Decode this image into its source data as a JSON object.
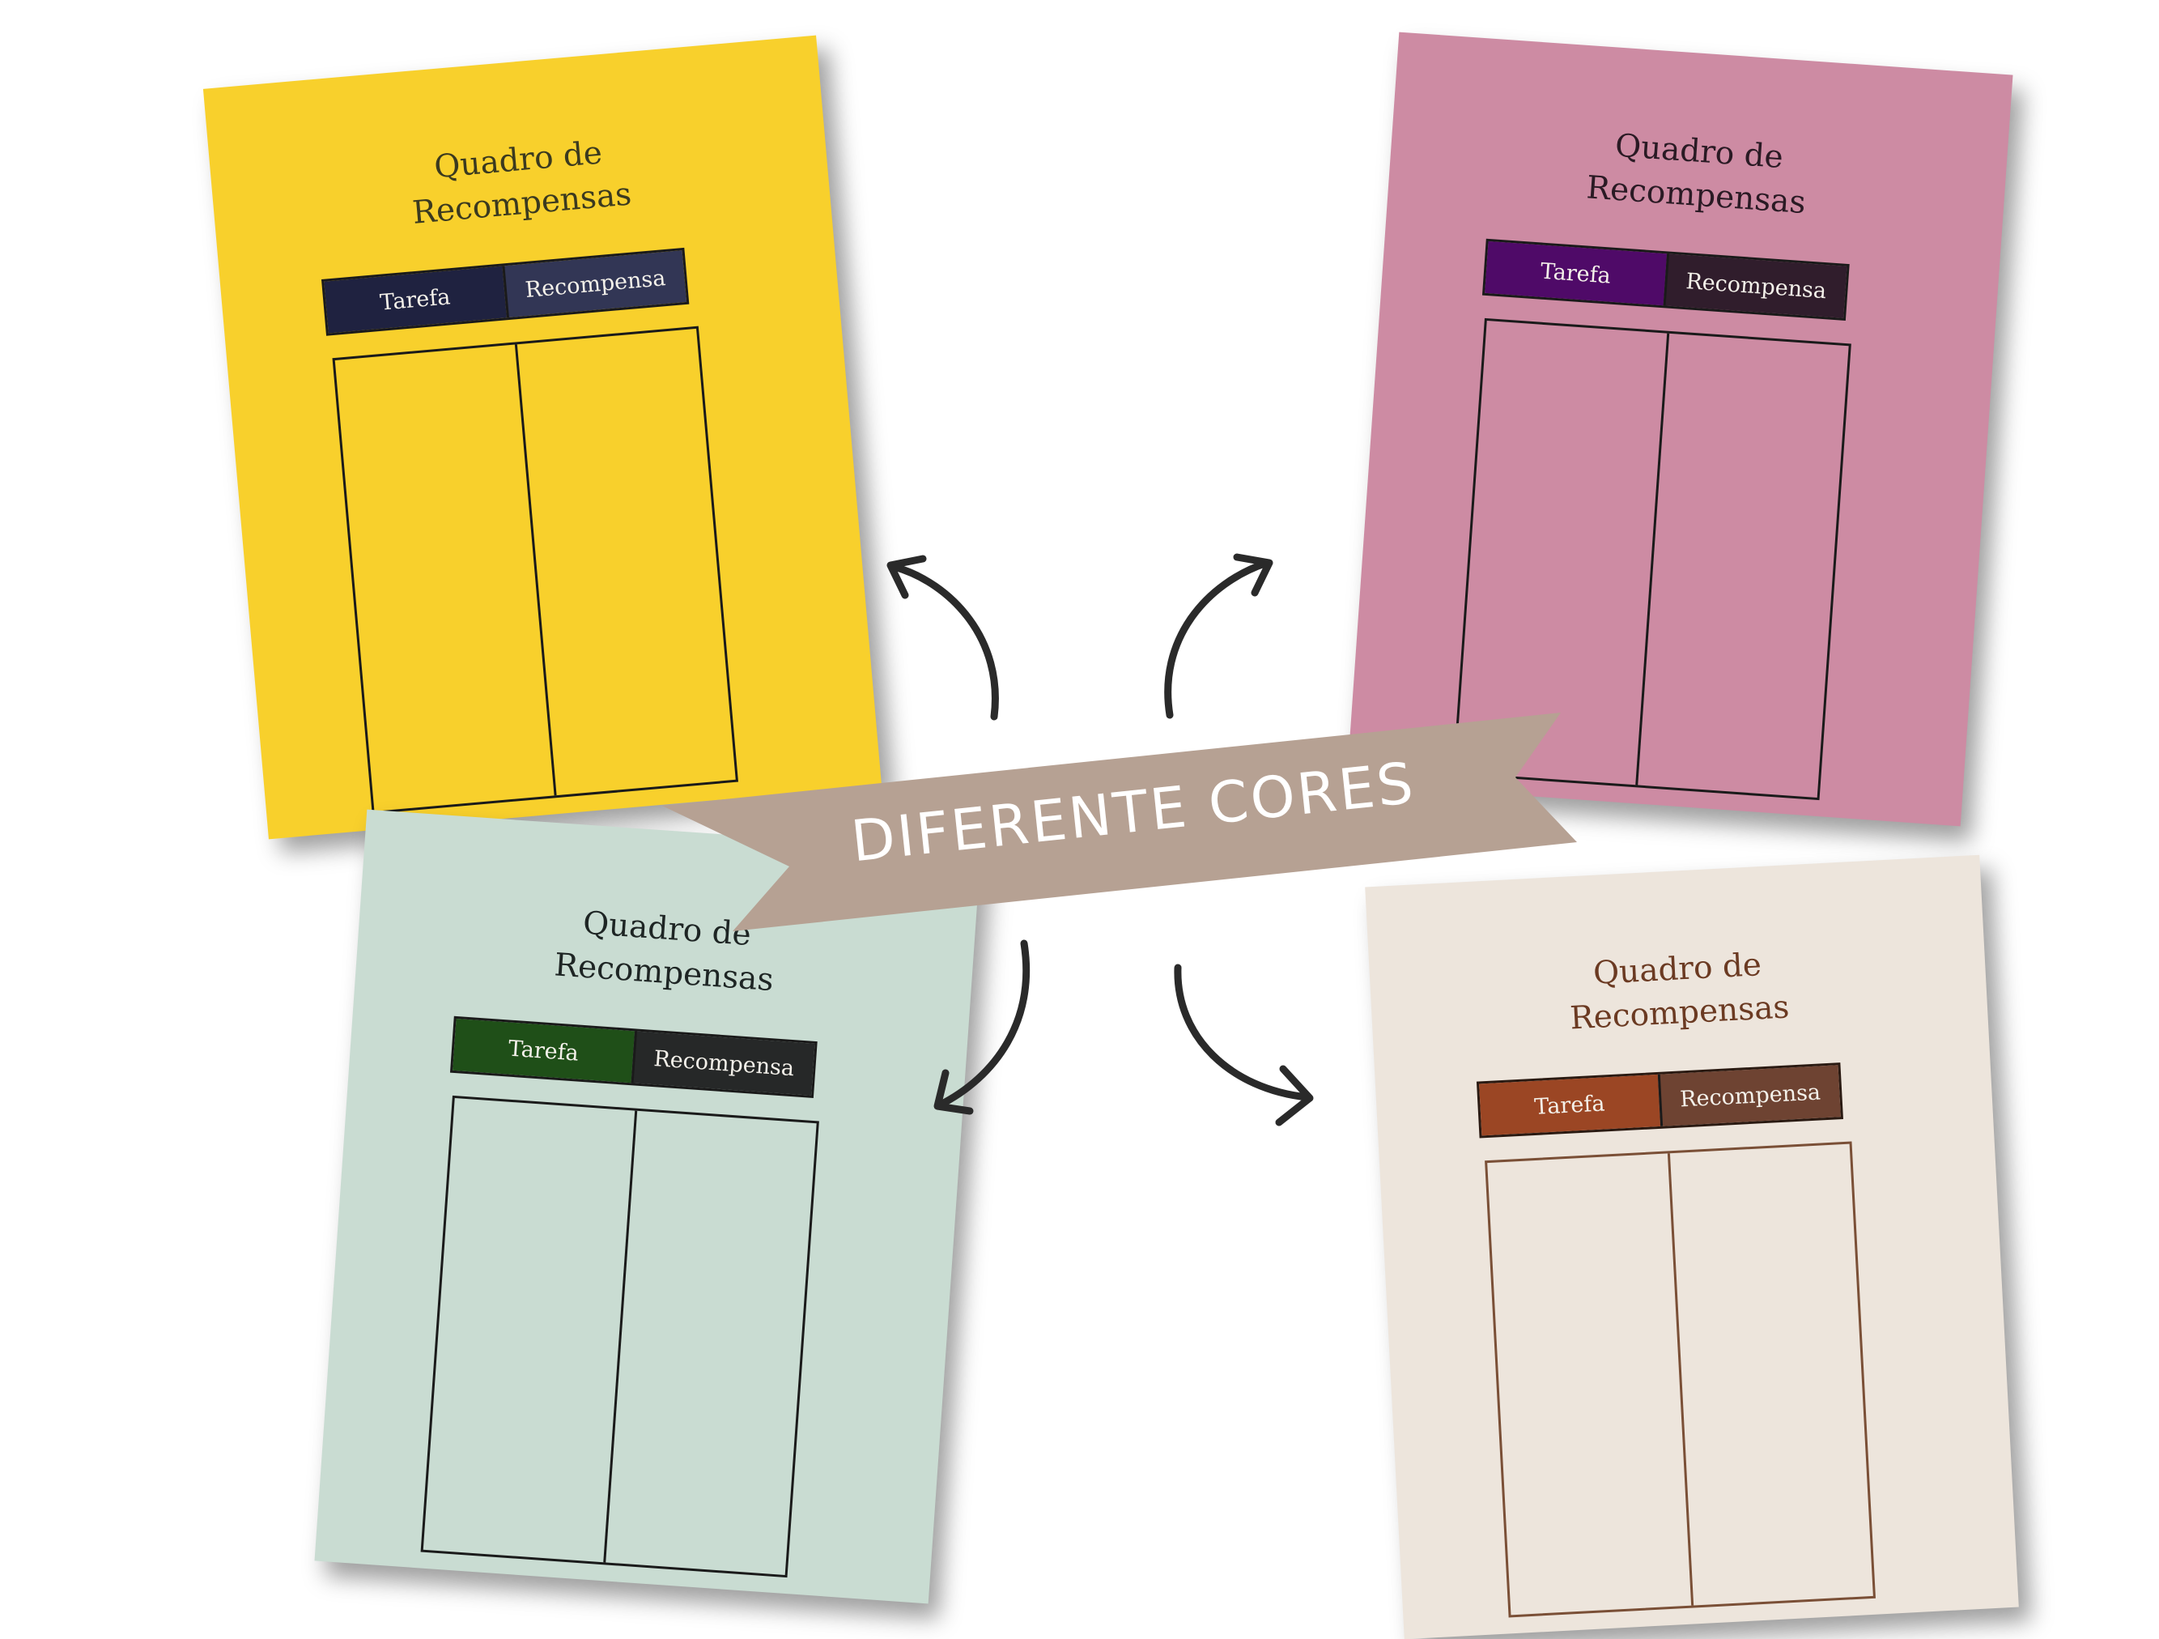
{
  "banner": {
    "text": "DIFERENTE CORES",
    "color": "#b6a193"
  },
  "cards": [
    {
      "id": "yellow",
      "background": "#f8d02c",
      "title_line1": "Quadro de",
      "title_line2": "Recompensas",
      "header_left": "Tarefa",
      "header_right": "Recompensa",
      "header_left_color": "#1f2240",
      "header_right_color": "#323655"
    },
    {
      "id": "pink",
      "background": "#cd8ba3",
      "title_line1": "Quadro de",
      "title_line2": "Recompensas",
      "header_left": "Tarefa",
      "header_right": "Recompensa",
      "header_left_color": "#4f0a68",
      "header_right_color": "#301d2c"
    },
    {
      "id": "green",
      "background": "#c9dcd2",
      "title_line1": "Quadro de",
      "title_line2": "Recompensas",
      "header_left": "Tarefa",
      "header_right": "Recompensa",
      "header_left_color": "#1f4f18",
      "header_right_color": "#262828"
    },
    {
      "id": "cream",
      "background": "#ede5dc",
      "title_line1": "Quadro de",
      "title_line2": "Recompensas",
      "header_left": "Tarefa",
      "header_right": "Recompensa",
      "header_left_color": "#9b4624",
      "header_right_color": "#6e4332"
    }
  ]
}
